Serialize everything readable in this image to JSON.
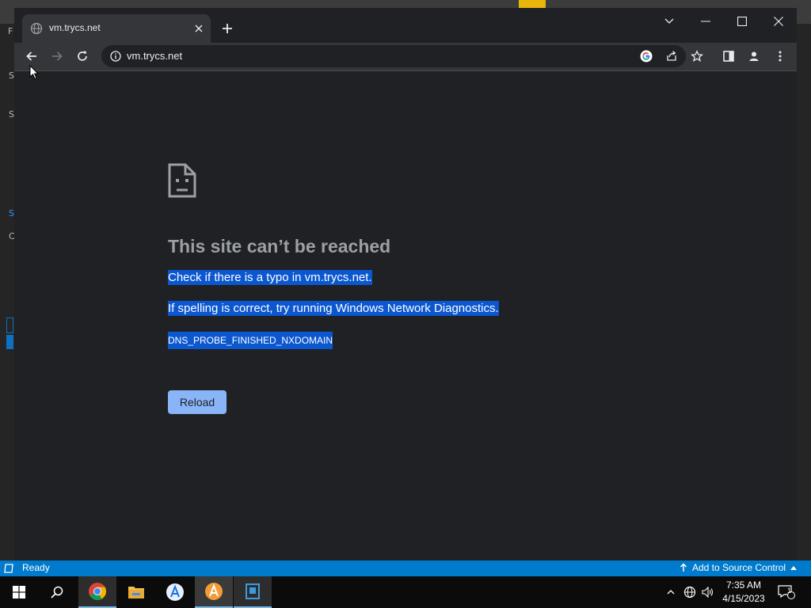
{
  "browser": {
    "tab": {
      "title": "vm.trycs.net",
      "favicon": "globe-icon"
    },
    "url": "vm.trycs.net",
    "toolbar_icons": [
      "back-arrow-icon",
      "forward-arrow-icon",
      "reload-icon",
      "info-icon",
      "google-icon",
      "share-icon",
      "star-icon",
      "side-panel-icon",
      "profile-icon",
      "kebab-menu-icon"
    ]
  },
  "error_page": {
    "title": "This site can’t be reached",
    "line1": "Check if there is a typo in vm.trycs.net.",
    "line2": "If spelling is correct, try running Windows Network Diagnostics.",
    "error_code": "DNS_PROBE_FINISHED_NXDOMAIN",
    "reload_label": "Reload"
  },
  "statusbar": {
    "ready": "Ready",
    "source_control": "Add to Source Control"
  },
  "taskbar": {
    "time": "7:35 AM",
    "date": "4/15/2023",
    "notification_count": "1"
  },
  "background_app": {
    "left_glyphs": [
      "F",
      "S",
      "S",
      "S",
      "C"
    ]
  },
  "colors": {
    "selection": "#0b57d0",
    "reload_button": "#8ab4f8",
    "statusbar": "#007acc"
  }
}
